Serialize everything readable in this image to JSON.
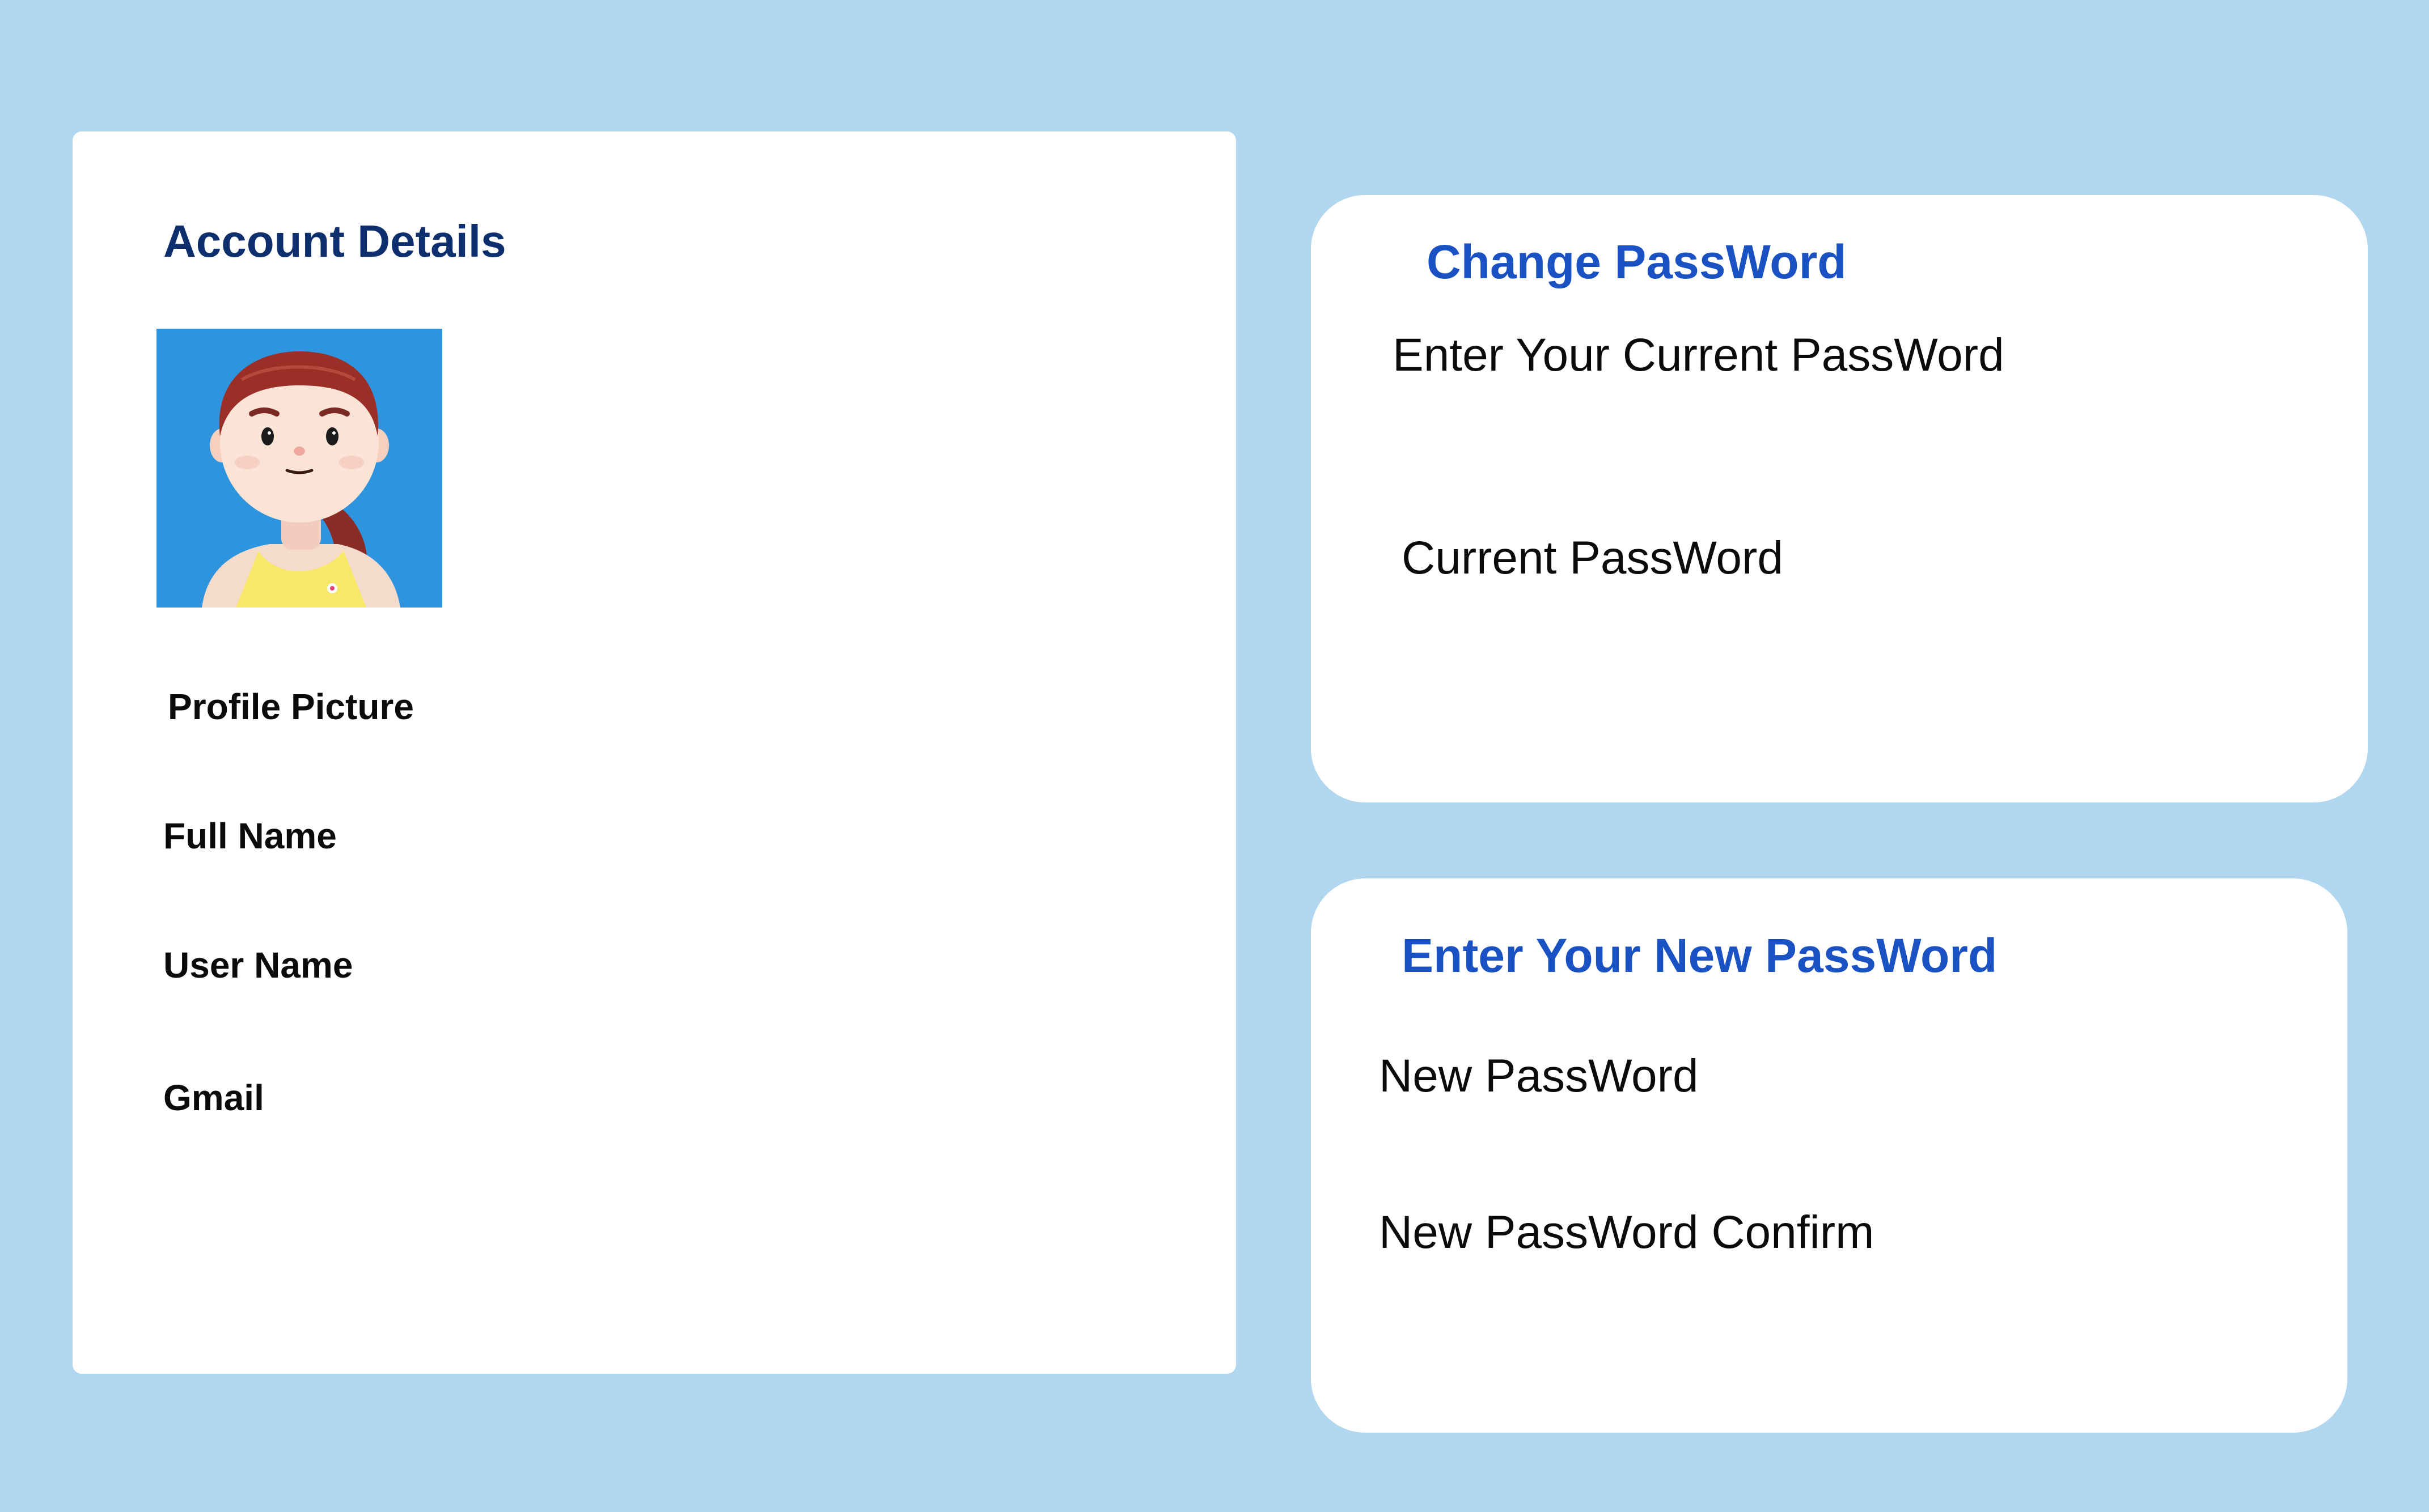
{
  "account": {
    "title": "Account Details",
    "profile_picture_label": "Profile Picture",
    "full_name_label": "Full Name",
    "user_name_label": "User Name",
    "gmail_label": "Gmail",
    "avatar_icon": "avatar-3d-girl"
  },
  "change_password": {
    "title": "Change PassWord",
    "prompt": "Enter Your Current PassWord",
    "current_label": "Current PassWord"
  },
  "new_password": {
    "title": "Enter Your New PassWord",
    "new_label": "New PassWord",
    "confirm_label": "New PassWord Confirm"
  },
  "colors": {
    "background": "#b1d6f0",
    "card": "#ffffff",
    "title_dark": "#0e2f6e",
    "title_blue": "#1a52c4",
    "avatar_bg": "#2e94dd"
  }
}
